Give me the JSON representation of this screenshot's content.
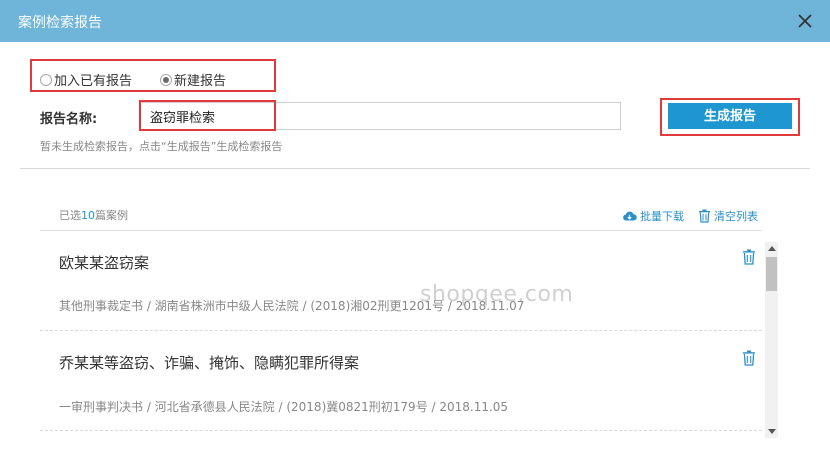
{
  "dialog": {
    "title": "案例检索报告",
    "close_icon": "close-icon"
  },
  "radios": [
    {
      "label": "加入已有报告",
      "checked": false
    },
    {
      "label": "新建报告",
      "checked": true
    }
  ],
  "form": {
    "name_label": "报告名称:",
    "name_value": "盗窃罪检索",
    "generate_label": "生成报告",
    "hint": "暂未生成检索报告，点击“生成报告”生成检索报告"
  },
  "list_header": {
    "count_prefix": "已选",
    "count": "10",
    "count_suffix": "篇案例",
    "download_label": "批量下载",
    "download_icon": "cloud-download-icon",
    "clear_label": "清空列表",
    "clear_icon": "trash-icon"
  },
  "cases": [
    {
      "title": "欧某某盗窃案",
      "meta": "其他刑事裁定书 / 湖南省株洲市中级人民法院 / (2018)湘02刑更1201号 / 2018.11.07"
    },
    {
      "title": "乔某某等盗窃、诈骗、掩饰、隐瞒犯罪所得案",
      "meta": "一审刑事判决书 / 河北省承德县人民法院 / (2018)冀0821刑初179号 / 2018.11.05"
    }
  ],
  "watermark": "shopqee.com",
  "colors": {
    "titlebar": "#6eb5d9",
    "accent": "#1e96cf",
    "highlight_box": "#e03a3a"
  }
}
